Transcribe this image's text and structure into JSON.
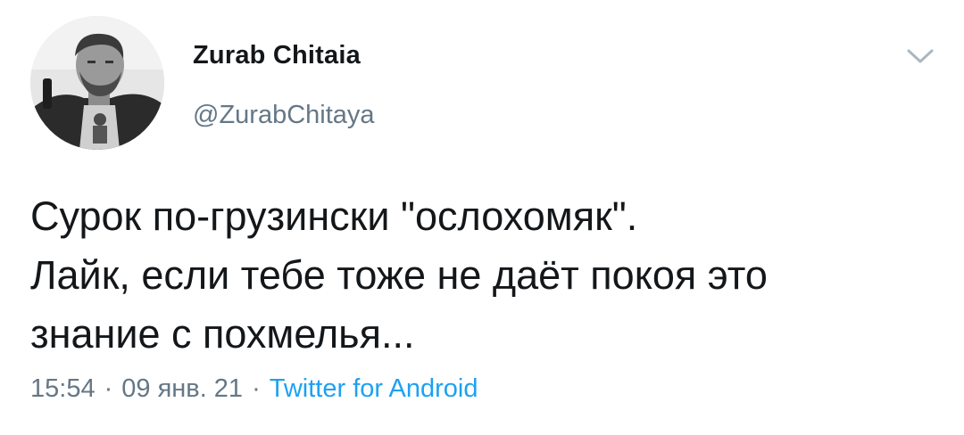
{
  "tweet": {
    "author": {
      "display_name": "Zurab Chitaia",
      "handle": "@ZurabChitaya",
      "avatar_icon": "profile-photo"
    },
    "menu_icon": "chevron-down-icon",
    "text_lines": [
      "Сурок по-грузински \"ослохомяк\".",
      "Лайк, если тебе тоже не даёт покоя это",
      "знание с похмелья..."
    ],
    "time": "15:54",
    "date": "09 янв. 21",
    "separator": "·",
    "source": "Twitter for Android"
  },
  "colors": {
    "text": "#14171a",
    "secondary": "#657786",
    "link": "#1da1f2",
    "caret": "#aab8c2"
  }
}
